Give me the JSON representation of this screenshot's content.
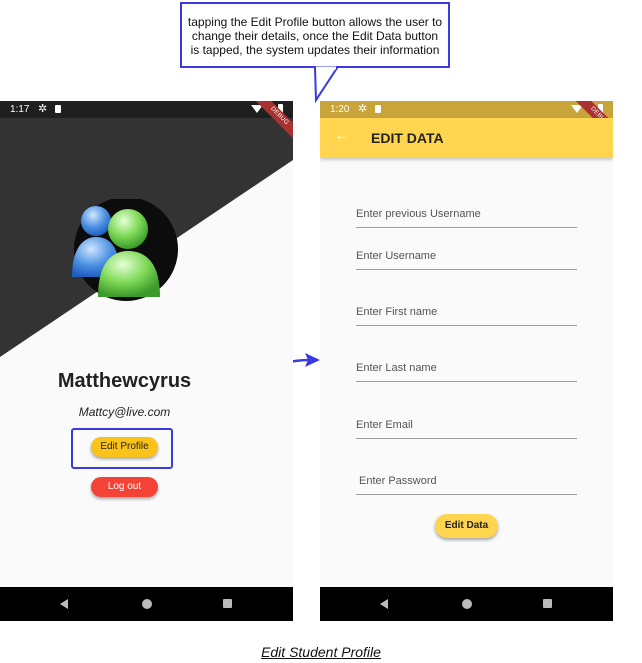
{
  "callout": {
    "text": "tapping the Edit Profile button allows the user to change their details, once the Edit Data button is tapped, the system updates their information"
  },
  "left_phone": {
    "status_time": "1:17",
    "debug_banner": "DEBUG",
    "username": "Matthewcyrus",
    "email": "Mattcy@live.com",
    "edit_profile_label": "Edit Profile",
    "logout_label": "Log out"
  },
  "right_phone": {
    "status_time": "1:20",
    "debug_banner": "DEBUG",
    "appbar_title": "EDIT DATA",
    "fields": [
      "Enter previous Username",
      "Enter Username",
      "Enter First name",
      "Enter Last name",
      "Enter Email",
      "Enter Password"
    ],
    "edit_data_label": "Edit Data"
  },
  "caption": "Edit Student Profile",
  "colors": {
    "accent_blue": "#3a3ae0",
    "appbar_yellow": "#ffd54f",
    "edit_button": "#f9c319",
    "logout_button": "#f44336"
  }
}
